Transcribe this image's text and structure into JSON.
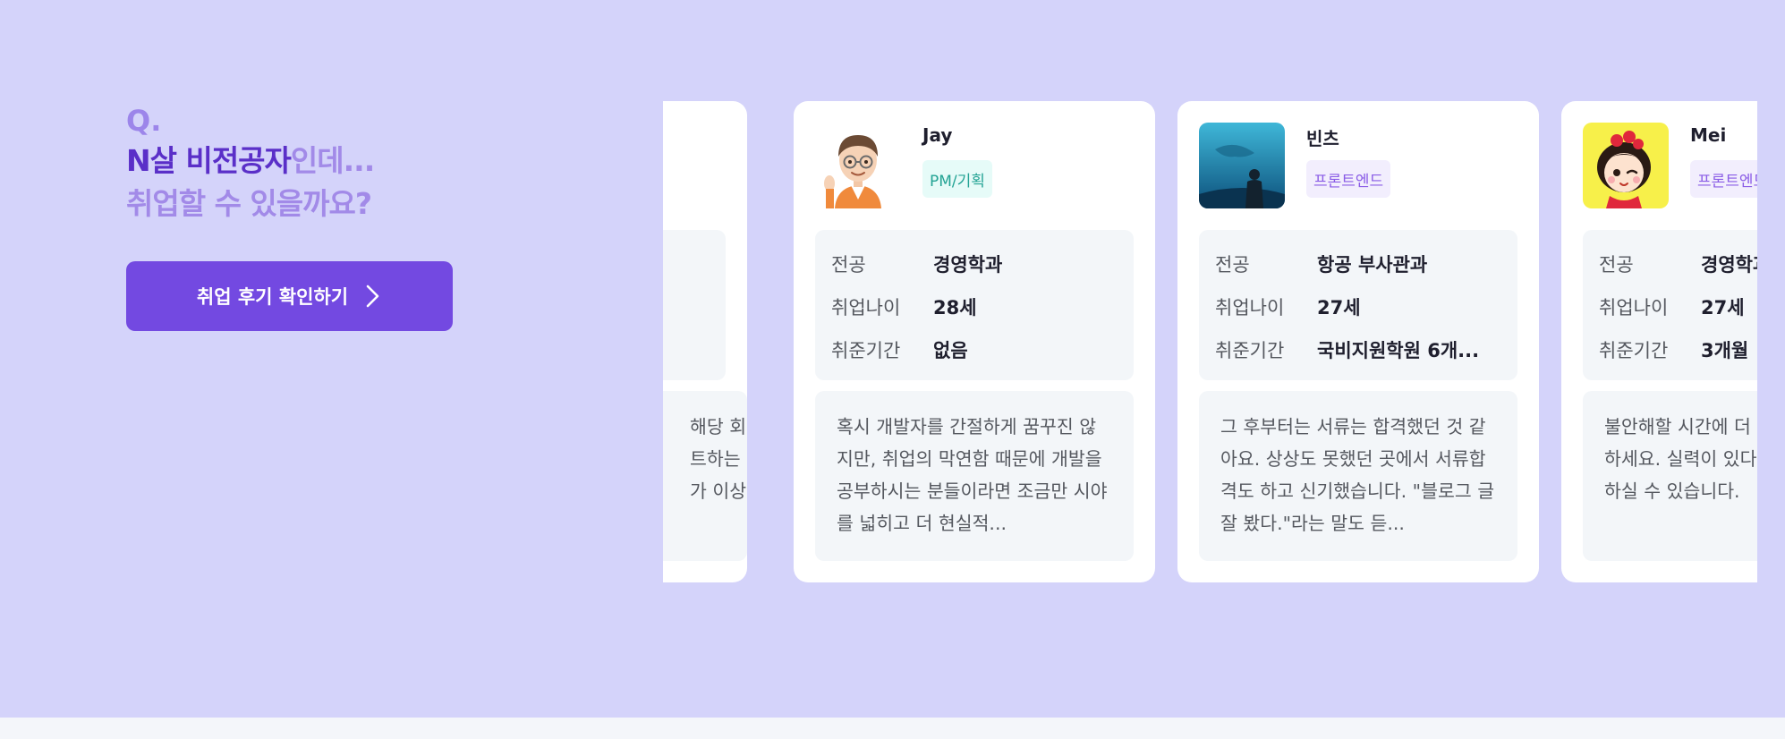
{
  "hero": {
    "q_mark": "Q.",
    "line1_strong": "N살 비전공자",
    "line1_soft": "인데...",
    "line2": "취업할 수 있을까요?",
    "cta_label": "취업 후기 확인하기"
  },
  "colors": {
    "hero_bg": "#d4d3fa",
    "accent": "#7349e1",
    "pm_tag": "#23a394",
    "fe_tag": "#8a5ce6"
  },
  "cards": [
    {
      "name": "",
      "tag": "",
      "info": [
        {
          "key": "",
          "value": ""
        },
        {
          "key": "",
          "value": ""
        },
        {
          "key": "",
          "value": ""
        }
      ],
      "review": "해당 회\n트하는\n가 이상"
    },
    {
      "name": "Jay",
      "tag": "PM/기획",
      "avatar_icon": "cartoon-man-avatar",
      "info": [
        {
          "key": "전공",
          "value": "경영학과"
        },
        {
          "key": "취업나이",
          "value": "28세"
        },
        {
          "key": "취준기간",
          "value": "없음"
        }
      ],
      "review": "혹시 개발자를 간절하게 꿈꾸진 않지만, 취업의 막연함 때문에 개발을 공부하시는 분들이라면 조금만 시야를 넓히고 더 현실적..."
    },
    {
      "name": "빈츠",
      "tag": "프론트엔드",
      "avatar_icon": "aquarium-photo-avatar",
      "info": [
        {
          "key": "전공",
          "value": "항공 부사관과"
        },
        {
          "key": "취업나이",
          "value": "27세"
        },
        {
          "key": "취준기간",
          "value": "국비지원학원 6개..."
        }
      ],
      "review": "그 후부터는 서류는 합격했던 것 같아요. 상상도 못했던 곳에서 서류합격도 하고 신기했습니다. \"블로그 글 잘 봤다.\"라는 말도 듣..."
    },
    {
      "name": "Mei",
      "tag": "프론트엔드",
      "avatar_icon": "cartoon-girl-avatar",
      "info": [
        {
          "key": "전공",
          "value": "경영학과"
        },
        {
          "key": "취업나이",
          "value": "27세"
        },
        {
          "key": "취준기간",
          "value": "3개월"
        }
      ],
      "review": "불안해할 시간에 더 집중하여 공부하세요. 실력이 있다면 취업 분명히 하실 수 있습니다."
    }
  ]
}
